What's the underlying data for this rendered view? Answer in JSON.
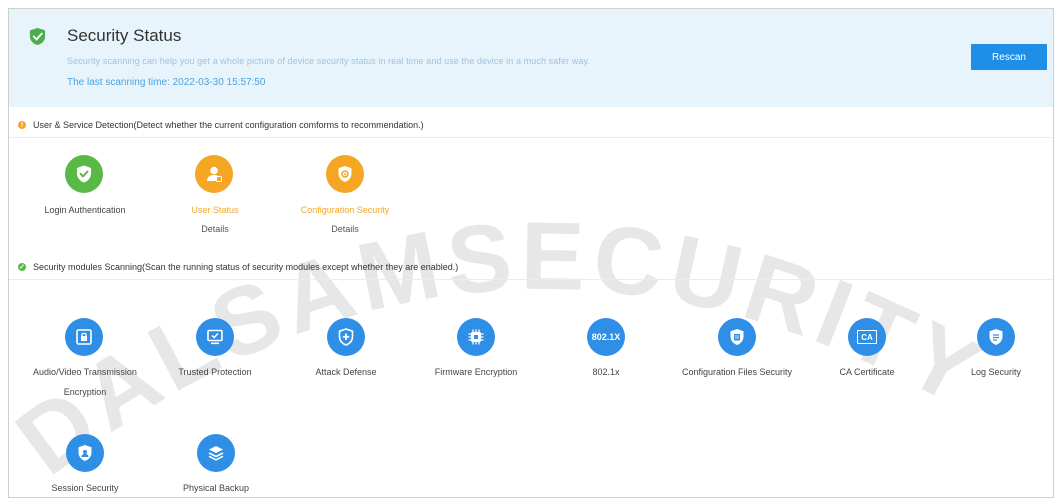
{
  "header": {
    "title": "Security Status",
    "description": "Security scanning can help you get a whole picture of device security status in real time and use the device in a much safer way.",
    "last_scan": "The last scanning time: 2022-03-30 15:57:50",
    "rescan_label": "Rescan"
  },
  "detection": {
    "heading": "User & Service Detection(Detect whether the current configuration comforms to recommendation.)",
    "items": [
      {
        "label": "Login Authentication",
        "status": "ok",
        "icon": "shield-check-icon"
      },
      {
        "label": "User Status",
        "status": "warning",
        "details": "Details",
        "icon": "user-icon"
      },
      {
        "label": "Configuration Security",
        "status": "warning",
        "details": "Details",
        "icon": "config-shield-icon"
      }
    ]
  },
  "modules": {
    "heading": "Security modules Scanning(Scan the running status of security modules except whether they are enabled.)",
    "items": [
      {
        "label": "Audio/Video Transmission",
        "label2": "Encryption",
        "icon": "av-encryption-icon"
      },
      {
        "label": "Trusted Protection",
        "icon": "monitor-check-icon"
      },
      {
        "label": "Attack Defense",
        "icon": "shield-plus-icon"
      },
      {
        "label": "Firmware Encryption",
        "icon": "chip-icon"
      },
      {
        "label": "802.1x",
        "icon_text": "802.1X",
        "icon": "8021x-icon"
      },
      {
        "label": "Configuration Files Security",
        "icon": "file-shield-icon"
      },
      {
        "label": "CA Certificate",
        "icon_text": "CA",
        "icon": "ca-certificate-icon"
      },
      {
        "label": "Log Security",
        "icon": "log-icon"
      },
      {
        "label": "Session Security",
        "icon": "session-shield-icon"
      },
      {
        "label": "Physical Backup",
        "icon": "layers-icon"
      }
    ]
  },
  "watermark": "DALSAMSECURITY",
  "colors": {
    "ok": "#58b947",
    "warning": "#f5a623",
    "module": "#2f8ee5",
    "primary": "#1e8fe7"
  }
}
